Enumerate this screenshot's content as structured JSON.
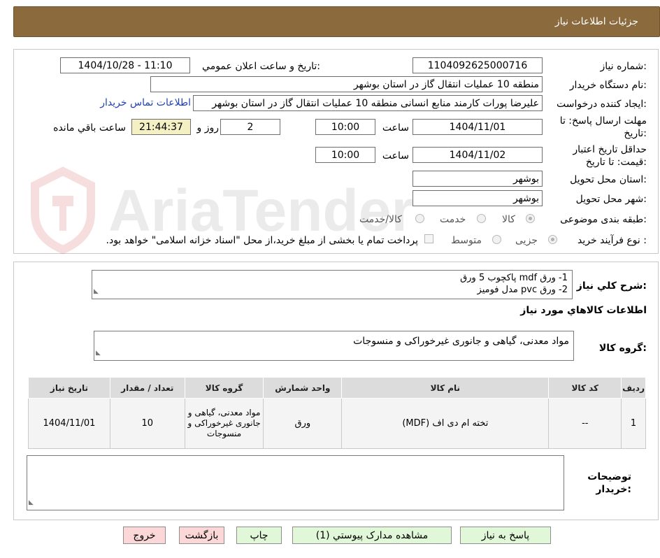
{
  "header": {
    "title": "جزئيات اطلاعات نياز"
  },
  "form": {
    "need_number_label": "شماره نياز:",
    "need_number": "1104092625000716",
    "announce_label": "تاريخ و ساعت اعلان عمومي:",
    "announce_value": "1404/10/28 - 11:10",
    "buyer_org_label": "نام دستگاه خريدار:",
    "buyer_org": "منطقه 10 عملیات انتقال گاز در استان بوشهر",
    "requester_label": "ايجاد کننده درخواست:",
    "requester": "علیرضا پورات کارمند منابع انسانی منطقه 10 عملیات انتقال گاز در استان بوشهر",
    "contact_link": "اطلاعات تماس خريدار",
    "deadline_label": "مهلت ارسال پاسخ: تا تاريخ:",
    "deadline_date": "1404/11/01",
    "time_label": "ساعت",
    "deadline_time": "10:00",
    "days_value": "2",
    "days_label": "روز و",
    "remaining_time": "21:44:37",
    "remaining_label": "ساعت باقي مانده",
    "price_validity_label": "حداقل تاريخ اعتبار قيمت: تا تاريخ:",
    "price_validity_date": "1404/11/02",
    "price_validity_time": "10:00",
    "province_label": "استان محل تحويل:",
    "province": "بوشهر",
    "city_label": "شهر محل تحويل:",
    "city": "بوشهر",
    "category_label": "طبقه بندی موضوعی:",
    "category_options": [
      "کالا",
      "خدمت",
      "کالا/خدمت"
    ],
    "process_label": "نوع فرآيند خريد :",
    "process_options": [
      "جزیی",
      "متوسط"
    ],
    "payment_note": "پرداخت تمام يا بخشی از مبلغ خريد،از محل \"اسناد خزانه اسلامی\" خواهد بود."
  },
  "summary": {
    "label": "شرح کلي نياز:",
    "lines": [
      "1- ورق mdf پاکچوب 5 ورق",
      "2- ورق pvc مدل فومیز"
    ]
  },
  "goods_info": {
    "title": "اطلاعات کالاهاي مورد نياز",
    "group_label": "گروه کالا:",
    "group_value": "مواد معدنی، گیاهی و جانوری غیرخوراکی و منسوجات",
    "columns": [
      "رديف",
      "کد کالا",
      "نام کالا",
      "واحد شمارش",
      "گروه کالا",
      "تعداد / مقدار",
      "تاريخ نياز"
    ],
    "rows": [
      {
        "row": "1",
        "code": "--",
        "name": "تخته ام دی اف (MDF)",
        "unit": "ورق",
        "group": "مواد معدنی، گیاهی و جانوری غیرخوراکی و منسوجات",
        "qty": "10",
        "date": "1404/11/01"
      }
    ]
  },
  "buyer_notes": {
    "label": "توضيحات خريدار:",
    "value": ""
  },
  "buttons": {
    "reply": "پاسخ به نياز",
    "attachments": "مشاهده مدارک پيوستي (1)",
    "print": "چاپ",
    "back": "بازگشت",
    "exit": "خروج"
  },
  "watermark": {
    "text": "AriaTender.net"
  }
}
